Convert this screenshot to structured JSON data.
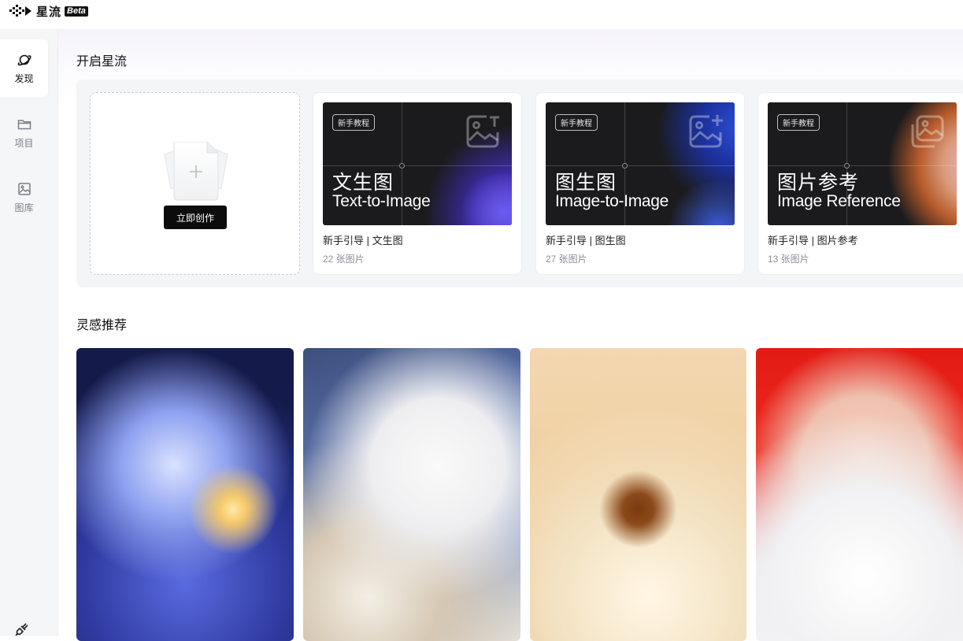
{
  "app": {
    "name": "星流",
    "badge": "Beta"
  },
  "sidebar": {
    "items": [
      {
        "label": "发现",
        "icon": "planet-icon",
        "active": true
      },
      {
        "label": "项目",
        "icon": "folder-icon",
        "active": false
      },
      {
        "label": "图库",
        "icon": "image-icon",
        "active": false
      }
    ],
    "bottom_icon": "settings-tool-icon"
  },
  "start_section": {
    "title": "开启星流",
    "create_button": "立即创作",
    "tutorials": [
      {
        "badge": "新手教程",
        "title_cn": "文生图",
        "title_en": "Text-to-Image",
        "name": "新手引导 | 文生图",
        "count": "22 张图片",
        "icon": "text-image-icon"
      },
      {
        "badge": "新手教程",
        "title_cn": "图生图",
        "title_en": "Image-to-Image",
        "name": "新手引导 | 图生图",
        "count": "27 张图片",
        "icon": "image-plus-icon"
      },
      {
        "badge": "新手教程",
        "title_cn": "图片参考",
        "title_en": "Image Reference",
        "name": "新手引导 | 图片参考",
        "count": "13 张图片",
        "icon": "image-stack-icon"
      }
    ]
  },
  "inspiration_section": {
    "title": "灵感推荐",
    "images": [
      {
        "subject": "anime-girl-starry-light"
      },
      {
        "subject": "white-wolf-and-woman"
      },
      {
        "subject": "serum-bottle-orchid"
      },
      {
        "subject": "red-hair-girl-white-cat"
      }
    ]
  },
  "colors": {
    "accent": "#0c0c0c",
    "sidebar_bg": "#f5f6f8",
    "section_bg": "#f4f5f7"
  }
}
